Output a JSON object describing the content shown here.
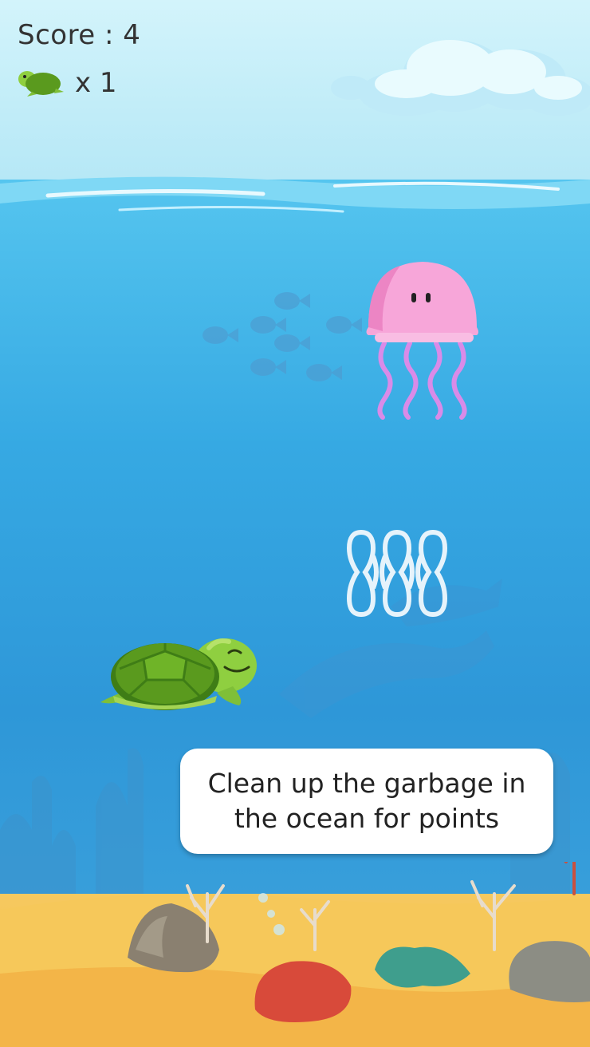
{
  "hud": {
    "score_text": "Score : 4",
    "lives_text": "x 1",
    "lives_icon": "turtle-icon"
  },
  "hint": {
    "text": "Clean up the garbage in the ocean for points"
  },
  "colors": {
    "sky": "#c9eff9",
    "ocean": "#36a9e3",
    "sand": "#f4bf52",
    "turtle_shell": "#5a9a1e",
    "turtle_skin": "#9cd64a",
    "jellyfish": "#f7a6d9",
    "jellyfish_tentacles": "#d98be8",
    "garbage_rings": "#e6f3fb"
  }
}
